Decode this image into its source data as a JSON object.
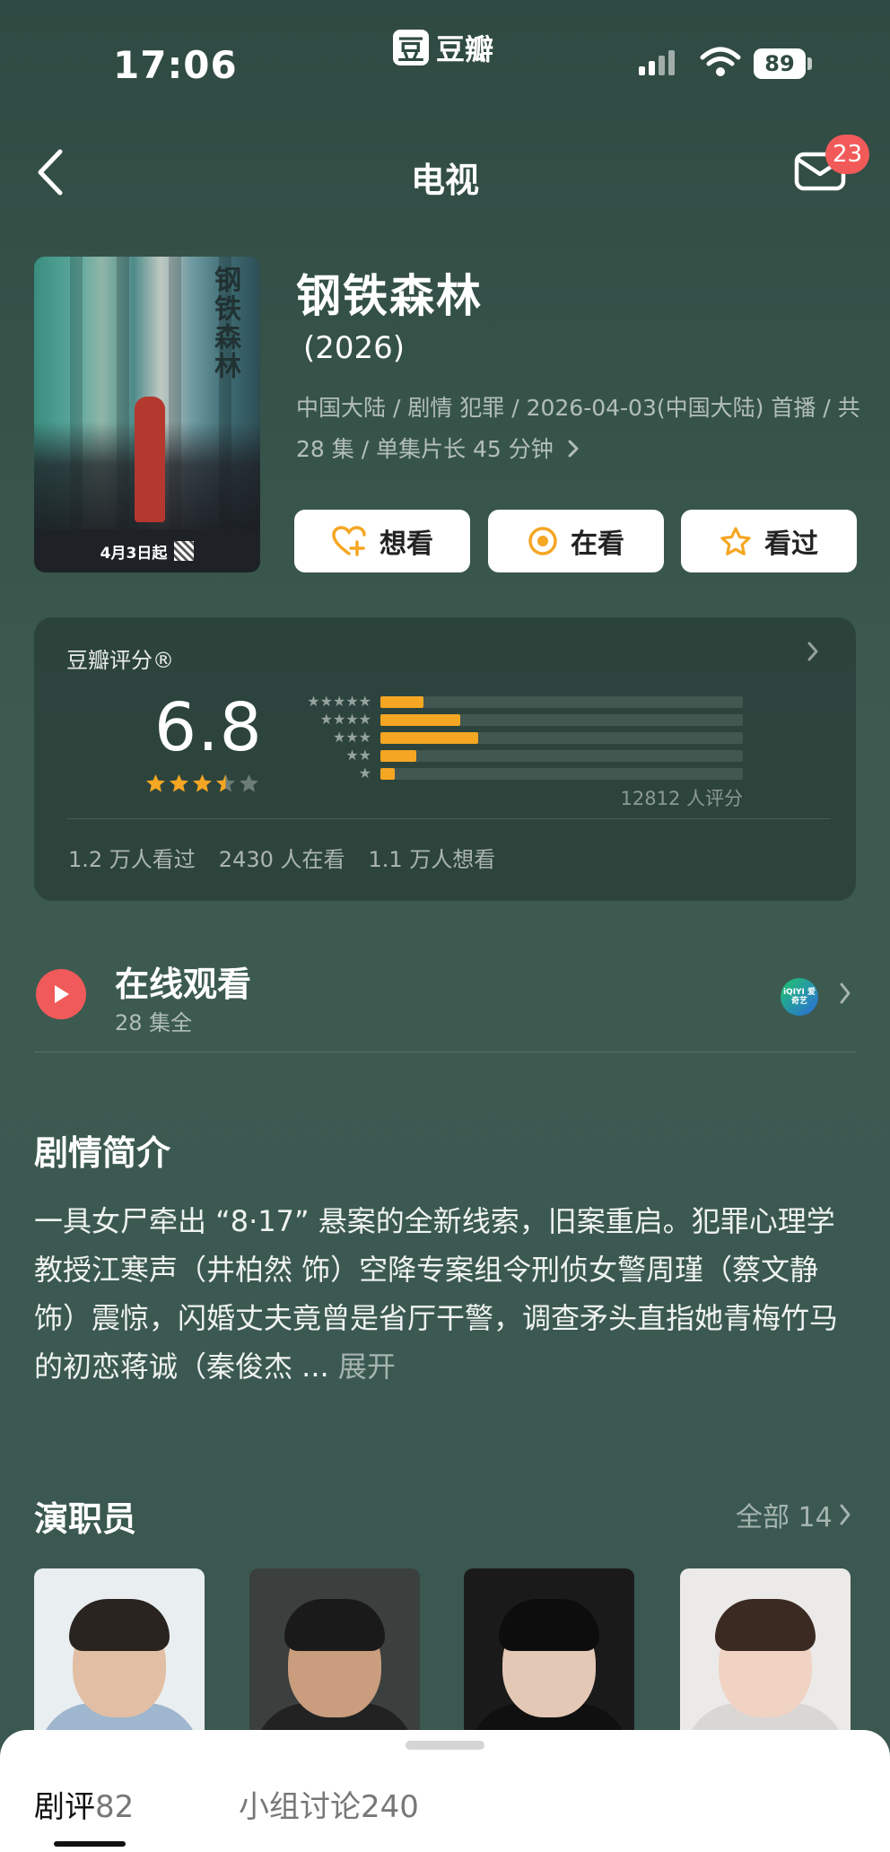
{
  "status_bar": {
    "time": "17:06",
    "app_logo_char": "豆",
    "app_name": "豆瓣",
    "battery": "89",
    "icons": [
      "signal-icon",
      "wifi-icon",
      "battery-icon"
    ]
  },
  "nav": {
    "title": "电视",
    "back_icon": "chevron-left-icon",
    "mail_icon": "mail-icon",
    "mail_badge": "23"
  },
  "show": {
    "title": "钢铁森林",
    "year": "(2026)",
    "meta": "中国大陆 / 剧情 犯罪 / 2026-04-03(中国大陆) 首播 / 共 28 集 / 单集片长 45 分钟",
    "poster_date": "4月3日起",
    "poster_title": "钢铁森林"
  },
  "actions": {
    "want": "想看",
    "watching": "在看",
    "watched": "看过"
  },
  "rating": {
    "label": "豆瓣评分®",
    "score": "6.8",
    "star_score_out_of_5": 3.5,
    "distribution_percent": [
      {
        "stars": 5,
        "percent": 12
      },
      {
        "stars": 4,
        "percent": 22
      },
      {
        "stars": 3,
        "percent": 27
      },
      {
        "stars": 2,
        "percent": 10
      },
      {
        "stars": 1,
        "percent": 4
      }
    ],
    "count": "12812 人评分",
    "stats": [
      "1.2 万人看过",
      "2430 人在看",
      "1.1 万人想看"
    ]
  },
  "watch": {
    "title": "在线观看",
    "subtitle": "28 集全",
    "platform_logo_text": "iQIYI 爱奇艺"
  },
  "synopsis": {
    "heading": "剧情简介",
    "text": "一具女尸牵出 “8·17” 悬案的全新线索，旧案重启。犯罪心理学教授江寒声（井柏然 饰）空降专案组令刑侦女警周瑾（蔡文静 饰）震惊，闪婚丈夫竟曾是省厅干警，调查矛头直指她青梅竹马的初恋蒋诚（秦俊杰 ...",
    "expand": "展开"
  },
  "cast": {
    "heading": "演职员",
    "all_label": "全部 14"
  },
  "bottom_sheet": {
    "tab_reviews_label": "剧评",
    "tab_reviews_count": "82",
    "tab_groups_label": "小组讨论",
    "tab_groups_count": "240"
  },
  "colors": {
    "accent_orange": "#f5a623",
    "play_red": "#f05a5a",
    "badge_red": "#f25a5a",
    "background": "#3c5a50"
  }
}
